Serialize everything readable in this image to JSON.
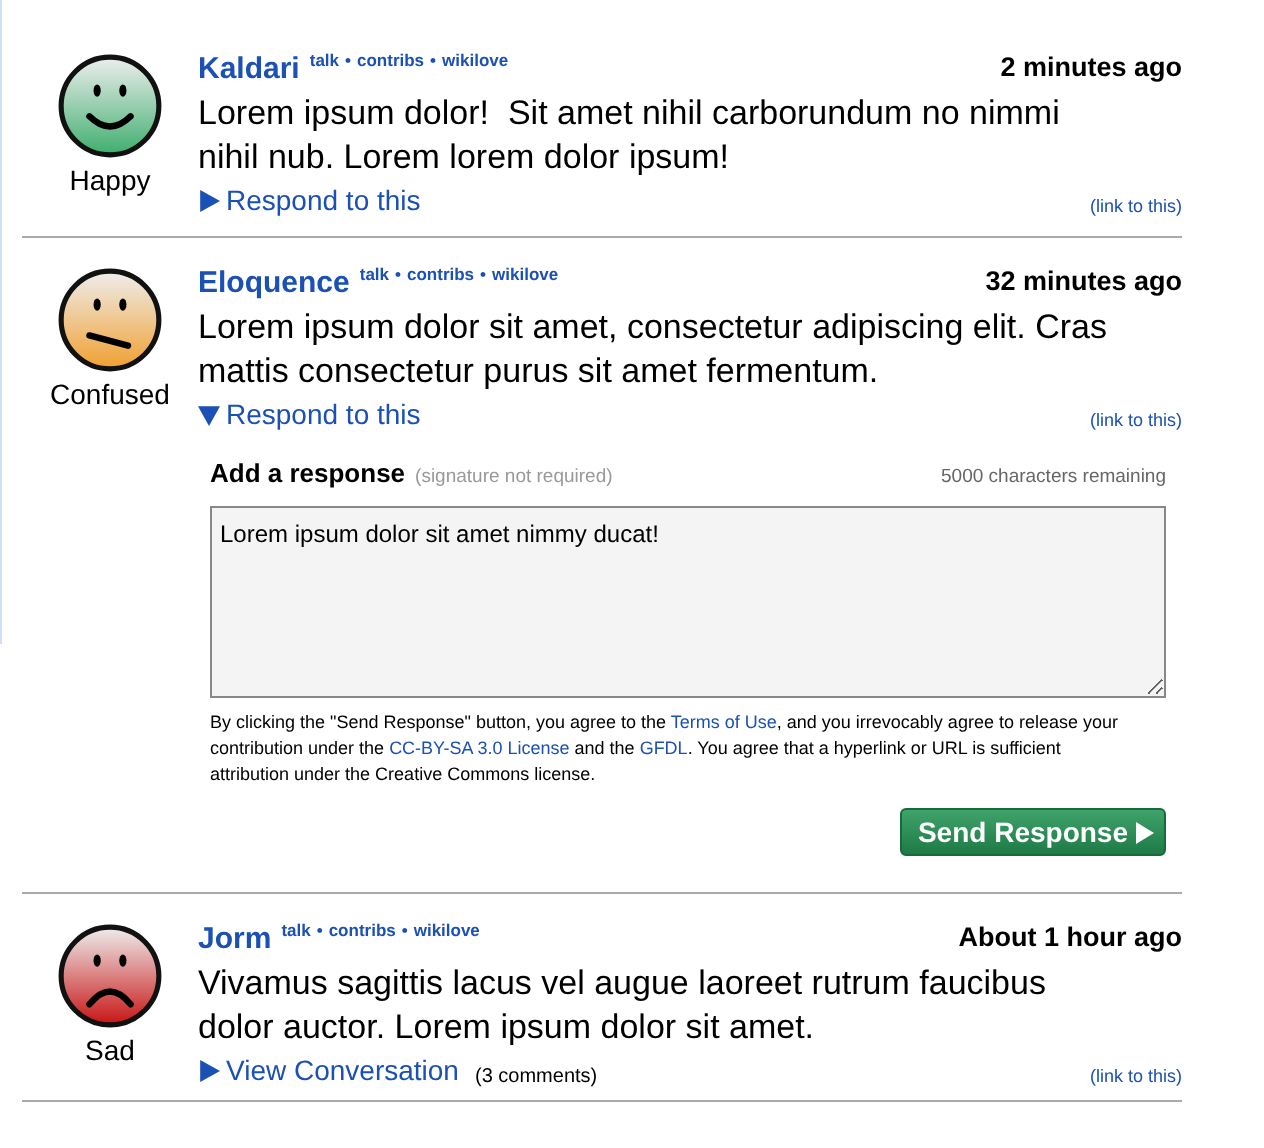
{
  "link_separator": "•",
  "posts": [
    {
      "mood": {
        "kind": "happy",
        "label": "Happy"
      },
      "author": "Kaldari",
      "links": [
        "talk",
        "contribs",
        "wikilove"
      ],
      "time": "2 minutes ago",
      "text": "Lorem ipsum dolor!  Sit amet nihil carborundum no nimmi nihil nub. Lorem lorem dolor ipsum!",
      "action": {
        "label": "Respond to this",
        "expanded": false
      },
      "permalink": "(link to this)"
    },
    {
      "mood": {
        "kind": "confused",
        "label": "Confused"
      },
      "author": "Eloquence",
      "links": [
        "talk",
        "contribs",
        "wikilove"
      ],
      "time": "32 minutes ago",
      "text": "Lorem ipsum dolor sit amet, consectetur adipiscing elit. Cras mattis consectetur purus sit amet fermentum.",
      "action": {
        "label": "Respond to this",
        "expanded": true
      },
      "permalink": "(link to this)",
      "reply_form": {
        "title": "Add a response",
        "hint": "(signature not required)",
        "counter": "5000 characters remaining",
        "value": "Lorem ipsum dolor sit amet nimmy ducat!",
        "terms": [
          {
            "text": "By clicking the \"Send Response\" button, you agree to the ",
            "link": false
          },
          {
            "text": "Terms of Use",
            "link": true
          },
          {
            "text": ", and you irrevocably agree to release your contribution under the ",
            "link": false
          },
          {
            "text": "CC-BY-SA 3.0 License",
            "link": true
          },
          {
            "text": " and the ",
            "link": false
          },
          {
            "text": "GFDL",
            "link": true
          },
          {
            "text": ". You agree that a hyperlink or URL is sufficient attribution under the Creative Commons license.",
            "link": false
          }
        ],
        "button": "Send Response"
      }
    },
    {
      "mood": {
        "kind": "sad",
        "label": "Sad"
      },
      "author": "Jorm",
      "links": [
        "talk",
        "contribs",
        "wikilove"
      ],
      "time": "About 1 hour ago",
      "text": "Vivamus sagittis lacus vel augue laoreet rutrum faucibus dolor auctor. Lorem ipsum dolor sit amet.",
      "action": {
        "label": "View Conversation",
        "expanded": false,
        "count": "(3 comments)"
      },
      "permalink": "(link to this)"
    }
  ]
}
